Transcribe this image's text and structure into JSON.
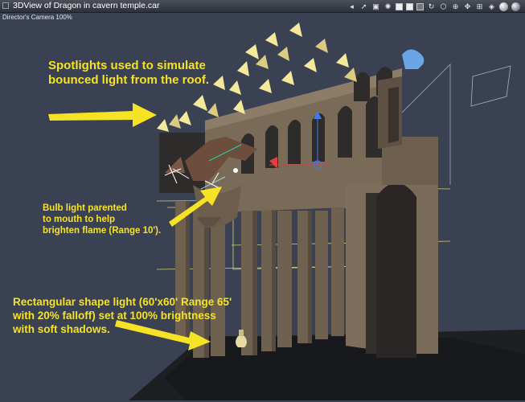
{
  "window": {
    "title": "3DView of Dragon in cavern temple.car",
    "camera_label": "Director's Camera 100%"
  },
  "toolbar": {
    "icons": [
      "mute-icon",
      "pointer-icon",
      "camera-icon",
      "light-icon",
      "render-square-icon",
      "render-square-icon",
      "render-square-dark-icon",
      "rotate-icon",
      "scale-icon",
      "zoom-icon",
      "pan-icon",
      "grid-icon",
      "cube-icon",
      "sphere-icon",
      "shaded-sphere-icon"
    ]
  },
  "annotations": {
    "spotlights": [
      "Spotlights used to simulate",
      "bounced light from the roof."
    ],
    "bulb": [
      "Bulb light parented",
      "to mouth to help",
      "brighten flame (Range 10')."
    ],
    "rect_light": [
      "Rectangular shape light (60'x60' Range 65'",
      "with 20% falloff) set at 100% brightness",
      "with soft shadows."
    ]
  },
  "colors": {
    "background": "#3a4153",
    "annotation": "#f6e326",
    "stone": "#7a6a58",
    "wireframe": "#d8cf7a",
    "floor": "#1e1f22"
  }
}
